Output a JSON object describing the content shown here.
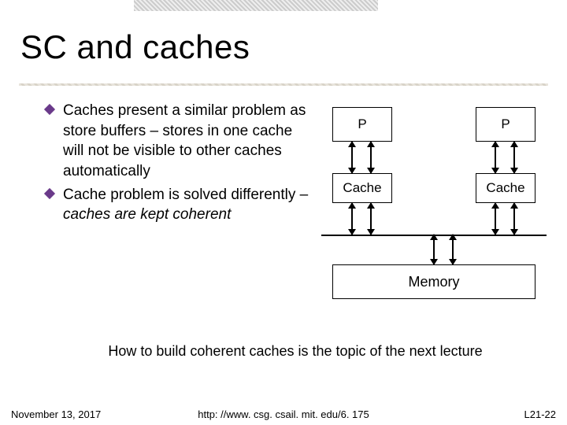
{
  "title": "SC and caches",
  "bullets": [
    {
      "text": "Caches present a similar problem as store buffers – stores in one cache will not be visible to other caches automatically"
    },
    {
      "text_html": "Cache problem is solved differently – <em>caches are kept coherent</em>",
      "text": "Cache problem is solved differently – caches are kept coherent"
    }
  ],
  "diagram": {
    "p1": "P",
    "p2": "P",
    "c1": "Cache",
    "c2": "Cache",
    "mem": "Memory"
  },
  "note": "How to build coherent caches is the topic of the next lecture",
  "footer": {
    "date": "November 13, 2017",
    "url": "http: //www. csg. csail. mit. edu/6. 175",
    "page": "L21-22"
  }
}
